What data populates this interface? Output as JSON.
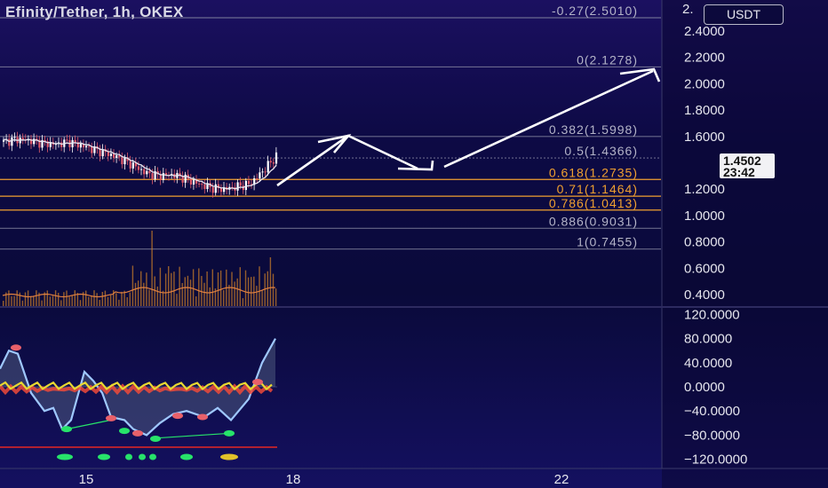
{
  "header": {
    "title": "Efinity/Tether, 1h, OKEX",
    "currency_button": "USDT",
    "top_axis_partial": "2."
  },
  "price_tag": {
    "value": "1.4502",
    "countdown": "23:42"
  },
  "colors": {
    "background": "#0d0a45",
    "candle_up": "#ffffff",
    "candle_down": "#e35a6a",
    "ma_line": "#e6e6f0",
    "fib_gray": "#8f8fa8",
    "fib_orange": "#f0a030",
    "volume_bar": "#c47a2a",
    "volume_ma": "#e08040",
    "osc_blue": "#9fc8ff",
    "osc_yellow": "#e8d830",
    "osc_red": "#ef4a3a",
    "dot_green": "#27e36a",
    "dot_yellow": "#e2c22a",
    "arrow": "#ffffff"
  },
  "fib_levels": [
    {
      "label": "-0.27(2.5010)",
      "color": "gray"
    },
    {
      "label": "0(2.1278)",
      "color": "gray"
    },
    {
      "label": "0.382(1.5998)",
      "color": "gray"
    },
    {
      "label": "0.5(1.4366)",
      "color": "gray"
    },
    {
      "label": "0.618(1.2735)",
      "color": "orange"
    },
    {
      "label": "0.71(1.1464)",
      "color": "orange"
    },
    {
      "label": "0.786(1.0413)",
      "color": "orange"
    },
    {
      "label": "0.886(0.9031)",
      "color": "gray"
    },
    {
      "label": "1(0.7455)",
      "color": "gray"
    }
  ],
  "price_axis": [
    "2.4000",
    "2.2000",
    "2.0000",
    "1.8000",
    "1.6000",
    "1.2000",
    "1.0000",
    "0.8000",
    "0.6000",
    "0.4000"
  ],
  "osc_axis": [
    "120.0000",
    "80.0000",
    "40.0000",
    "0.0000",
    "−40.0000",
    "−80.0000",
    "−120.0000"
  ],
  "time_axis": [
    "15",
    "18",
    "22"
  ],
  "chart_data": {
    "type": "line",
    "title": "Efinity/Tether, 1h, OKEX",
    "price_series": {
      "name": "",
      "x": [
        0,
        5,
        10,
        15,
        20,
        25,
        30,
        35,
        40,
        45,
        50,
        55,
        60,
        65,
        70,
        75,
        80,
        85,
        90,
        95,
        100,
        105
      ],
      "values": [
        1.56,
        1.58,
        1.57,
        1.55,
        1.54,
        1.56,
        1.53,
        1.5,
        1.47,
        1.43,
        1.38,
        1.32,
        1.3,
        1.31,
        1.28,
        1.24,
        1.21,
        1.2,
        1.22,
        1.24,
        1.34,
        1.45
      ]
    },
    "projection": {
      "name": "",
      "path_prices": [
        1.26,
        1.62,
        1.43,
        2.15
      ]
    },
    "ylim": [
      0.35,
      2.55
    ],
    "oscillator_ylim": [
      -120,
      120
    ]
  }
}
